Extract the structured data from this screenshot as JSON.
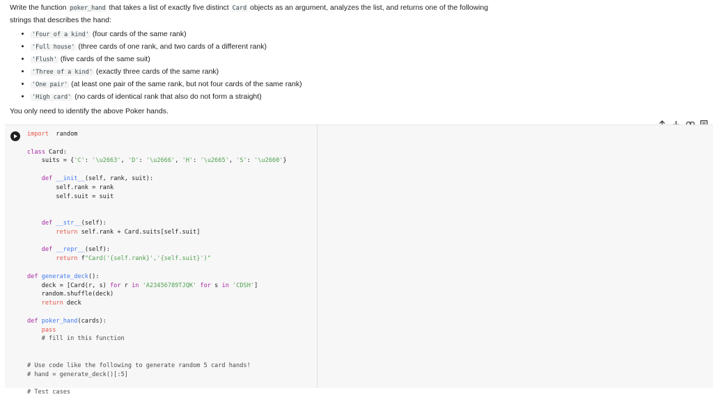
{
  "prompt": {
    "intro_a": "Write the function ",
    "intro_func": "poker_hand",
    "intro_b": " that takes a list of exactly five distinct ",
    "intro_card": "Card",
    "intro_c": " objects as an argument, analyzes the list, and returns one of the following strings that describes the hand:",
    "hands": [
      {
        "code": "'Four of a kind'",
        "desc": "(four cards of the same rank)"
      },
      {
        "code": "'Full house'",
        "desc": "(three cards of one rank, and two cards of a different rank)"
      },
      {
        "code": "'Flush'",
        "desc": "(five cards of the same suit)"
      },
      {
        "code": "'Three of a kind'",
        "desc": "(exactly three cards of the same rank)"
      },
      {
        "code": "'One pair'",
        "desc": "(at least one pair of the same rank, but not four cards of the same rank)"
      },
      {
        "code": "'High card'",
        "desc": "(no cards of identical rank that also do not form a straight)"
      }
    ],
    "note": "You only need to identify the above Poker hands."
  },
  "toolbar": {
    "icons": [
      "arrow-up-icon",
      "arrow-down-icon",
      "link-icon",
      "comment-icon"
    ]
  },
  "code_cell": {
    "lines": [
      [
        [
          "kw2",
          "import"
        ],
        [
          "",
          "  random"
        ]
      ],
      [
        [
          "",
          ""
        ]
      ],
      [
        [
          "kw",
          "class"
        ],
        [
          "",
          " Card:"
        ]
      ],
      [
        [
          "",
          "    suits = {"
        ],
        [
          "str",
          "'C'"
        ],
        [
          "",
          ": "
        ],
        [
          "str",
          "'\\u2663'"
        ],
        [
          "",
          ", "
        ],
        [
          "str",
          "'D'"
        ],
        [
          "",
          ": "
        ],
        [
          "str",
          "'\\u2666'"
        ],
        [
          "",
          ", "
        ],
        [
          "str",
          "'H'"
        ],
        [
          "",
          ": "
        ],
        [
          "str",
          "'\\u2665'"
        ],
        [
          "",
          ", "
        ],
        [
          "str",
          "'S'"
        ],
        [
          "",
          ": "
        ],
        [
          "str",
          "'\\u2660'"
        ],
        [
          "",
          "}"
        ]
      ],
      [
        [
          "",
          ""
        ]
      ],
      [
        [
          "",
          "    "
        ],
        [
          "kw",
          "def"
        ],
        [
          "fn",
          " __init__"
        ],
        [
          "",
          "(self, rank, suit):"
        ]
      ],
      [
        [
          "",
          "        self.rank = rank"
        ]
      ],
      [
        [
          "",
          "        self.suit = suit"
        ]
      ],
      [
        [
          "",
          ""
        ]
      ],
      [
        [
          "",
          ""
        ]
      ],
      [
        [
          "",
          "    "
        ],
        [
          "kw",
          "def"
        ],
        [
          "fn",
          " __str__"
        ],
        [
          "",
          "(self):"
        ]
      ],
      [
        [
          "",
          "        "
        ],
        [
          "kw2",
          "return"
        ],
        [
          "",
          " self.rank + Card.suits[self.suit]"
        ]
      ],
      [
        [
          "",
          ""
        ]
      ],
      [
        [
          "",
          "    "
        ],
        [
          "kw",
          "def"
        ],
        [
          "fn",
          " __repr__"
        ],
        [
          "",
          "(self):"
        ]
      ],
      [
        [
          "",
          "        "
        ],
        [
          "kw2",
          "return"
        ],
        [
          "",
          " f"
        ],
        [
          "str",
          "\"Card('{self.rank}','{self.suit}')\""
        ]
      ],
      [
        [
          "",
          ""
        ]
      ],
      [
        [
          "kw",
          "def"
        ],
        [
          "fn",
          " generate_deck"
        ],
        [
          "",
          "():"
        ]
      ],
      [
        [
          "",
          "    deck = [Card(r, s) "
        ],
        [
          "kw",
          "for"
        ],
        [
          "",
          " r "
        ],
        [
          "kw",
          "in"
        ],
        [
          "",
          " "
        ],
        [
          "str",
          "'A23456789TJQK'"
        ],
        [
          "",
          " "
        ],
        [
          "kw",
          "for"
        ],
        [
          "",
          " s "
        ],
        [
          "kw",
          "in"
        ],
        [
          "",
          " "
        ],
        [
          "str",
          "'CDSH'"
        ],
        [
          "",
          "]"
        ]
      ],
      [
        [
          "",
          "    random.shuffle(deck)"
        ]
      ],
      [
        [
          "",
          "    "
        ],
        [
          "kw2",
          "return"
        ],
        [
          "",
          " deck"
        ]
      ],
      [
        [
          "",
          ""
        ]
      ],
      [
        [
          "kw",
          "def"
        ],
        [
          "fn",
          " poker_hand"
        ],
        [
          "",
          "(cards):"
        ]
      ],
      [
        [
          "",
          "    "
        ],
        [
          "kw2",
          "pass"
        ]
      ],
      [
        [
          "cm",
          "    # fill in this function"
        ]
      ],
      [
        [
          "",
          ""
        ]
      ],
      [
        [
          "",
          ""
        ]
      ],
      [
        [
          "cm",
          "# Use code like the following to generate random 5 card hands!"
        ]
      ],
      [
        [
          "cm",
          "# hand = generate_deck()[:5]"
        ]
      ],
      [
        [
          "",
          ""
        ]
      ],
      [
        [
          "cm",
          "# Test cases"
        ]
      ]
    ]
  }
}
